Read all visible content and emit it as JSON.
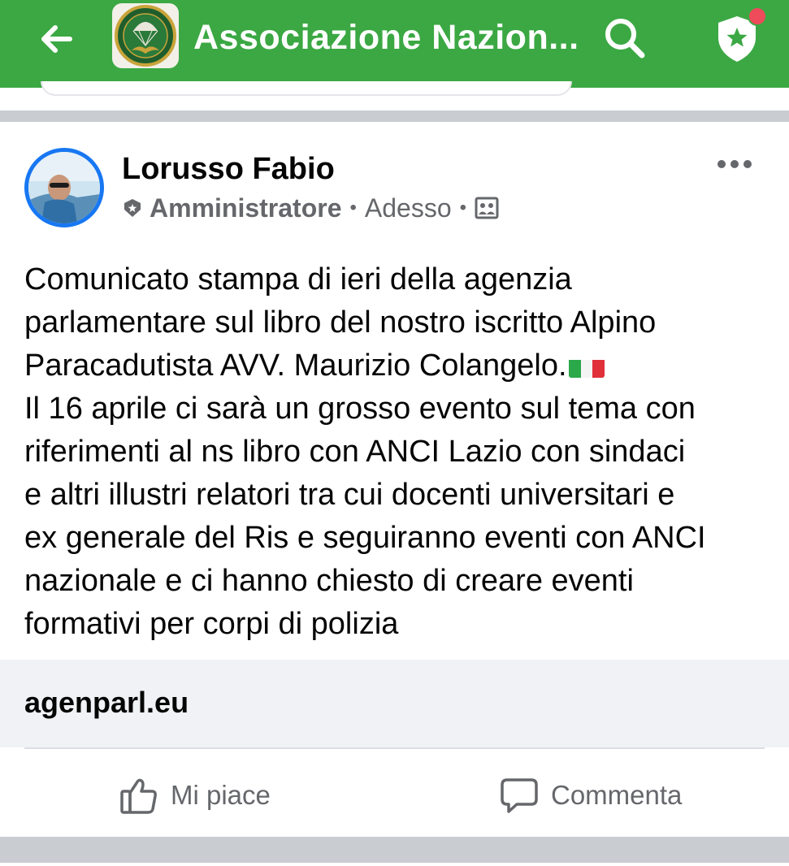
{
  "header": {
    "title": "Associazione  Nazion...",
    "back_icon": "arrow-left-icon",
    "search_icon": "search-icon",
    "admin_icon": "shield-star-icon",
    "background": "#3ba843",
    "notification_dot_color": "#ee4b5b"
  },
  "post": {
    "author": "Lorusso Fabio",
    "role": "Amministratore",
    "separator": "•",
    "time": "Adesso",
    "audience_icon": "group-audience-icon",
    "more_icon": "more-dots-icon",
    "text_lines": [
      "Comunicato stampa di ieri della agenzia",
      "parlamentare sul libro del nostro iscritto Alpino",
      "Paracadutista AVV. Maurizio Colangelo."
    ],
    "text_rest": "Il 16 aprile ci sarà un grosso evento sul tema con\nriferimenti al ns libro con ANCI Lazio con sindaci\ne altri illustri relatori tra cui docenti universitari e\nex generale del Ris e seguiranno eventi con ANCI\nnazionale e ci hanno chiesto di creare eventi\nformativi per corpi di polizia",
    "flag_icon": "italy-flag-icon",
    "link_domain": "agenparl.eu"
  },
  "actions": {
    "like_label": "Mi piace",
    "comment_label": "Commenta"
  },
  "colors": {
    "accent_blue": "#1877f2",
    "secondary_text": "#65676b",
    "divider": "#c9ccd1"
  }
}
